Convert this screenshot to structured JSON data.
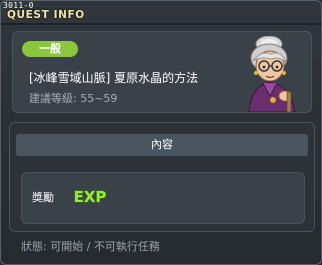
{
  "window": {
    "quest_id": "3011-0",
    "title": "QUEST INFO"
  },
  "quest": {
    "badge": "一般",
    "name": "[冰峰雪域山脈] 夏原水晶的方法",
    "level_label": "建議等級: 55~59"
  },
  "content": {
    "header": "內容",
    "reward_label": "獎勵",
    "reward_exp_text": "EXP"
  },
  "status": {
    "text": "狀態: 可開始 / 不可執行任務"
  },
  "colors": {
    "badge_bg": "#8cc63e",
    "title_color": "#f2e6a0",
    "exp_fill": "#9fe836",
    "exp_stroke": "#2f6b16"
  },
  "icons": {
    "npc": "elderly-woman-npc-portrait",
    "reward": "exp-logo"
  }
}
